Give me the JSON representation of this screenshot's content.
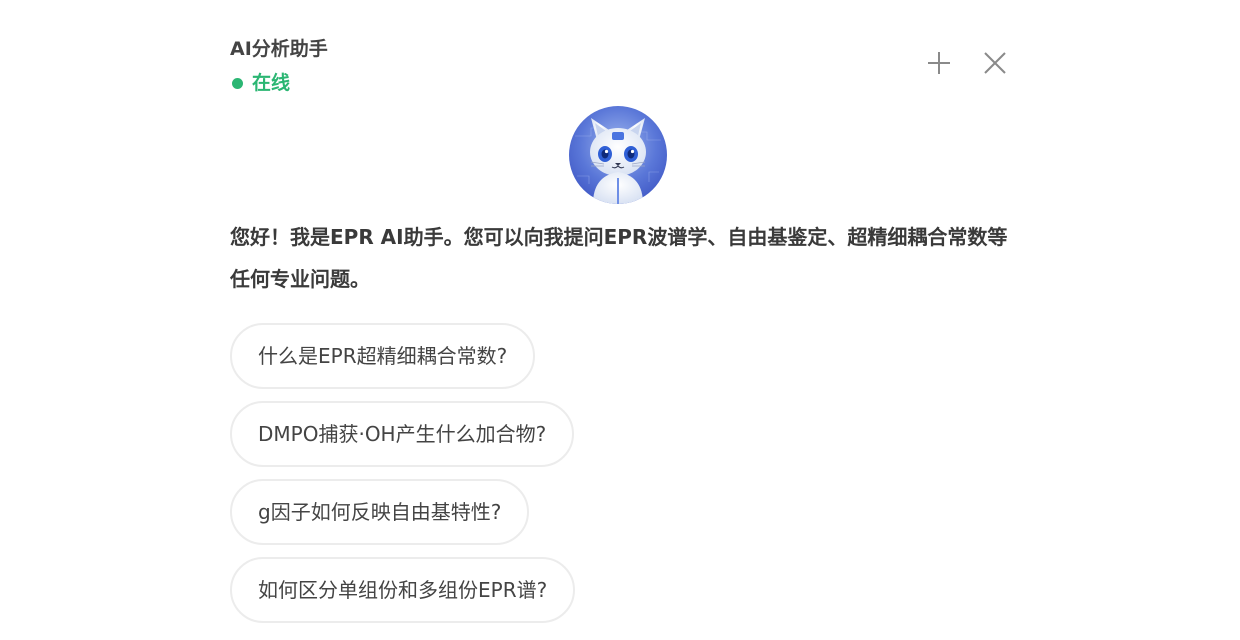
{
  "header": {
    "title": "AI分析助手",
    "status_label": "在线",
    "status_color": "#2bb673",
    "actions": [
      {
        "icon": "plus-icon"
      },
      {
        "icon": "close-icon"
      }
    ]
  },
  "assistant": {
    "avatar_icon": "robot-cat-avatar",
    "intro_text": "您好！我是EPR AI助手。您可以向我提问EPR波谱学、自由基鉴定、超精细耦合常数等任何专业问题。"
  },
  "suggestions": [
    "什么是EPR超精细耦合常数?",
    "DMPO捕获·OH产生什么加合物?",
    "g因子如何反映自由基特性?",
    "如何区分单组份和多组份EPR谱?"
  ]
}
